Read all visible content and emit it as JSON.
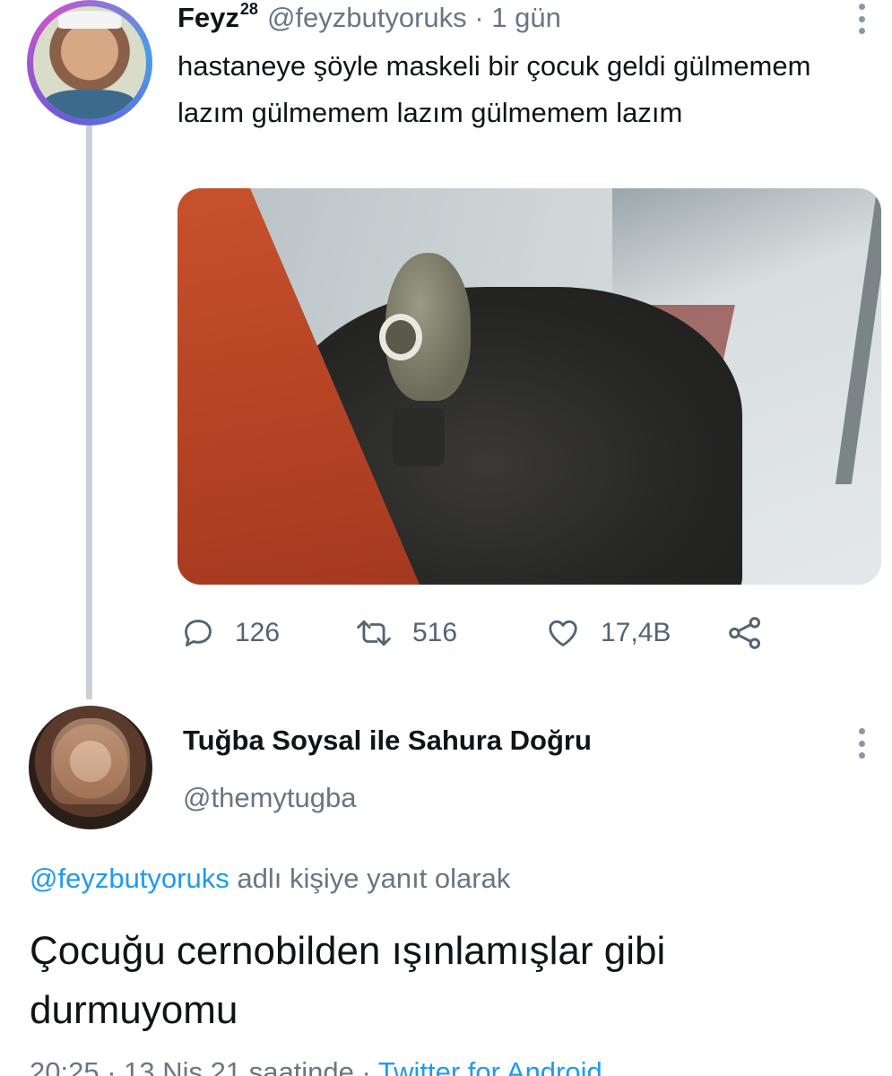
{
  "tweet": {
    "display_name": "Feyz",
    "display_name_suffix": "28",
    "handle": "@feyzbutyoruks",
    "separator": "·",
    "time": "1 gün",
    "text": "hastaneye şöyle maskeli bir çocuk geldi gülmemem lazım gülmemem lazım gülmemem lazım",
    "actions": {
      "replies": "126",
      "retweets": "516",
      "likes": "17,4B"
    }
  },
  "reply": {
    "display_name": "Tuğba Soysal ile Sahura Doğru",
    "handle": "@themytugba",
    "context_mention": "@feyzbutyoruks",
    "context_suffix": "adlı kişiye yanıt olarak",
    "text": "Çocuğu cernobilden ışınlamışlar gibi durmuyomu",
    "timestamp": "20:25 · 13 Nis 21 saatinde ·",
    "source": "Twitter for Android"
  },
  "colors": {
    "link_blue": "#1d9bf0",
    "muted_gray": "#687684",
    "thread_line": "#c8d1d8"
  }
}
